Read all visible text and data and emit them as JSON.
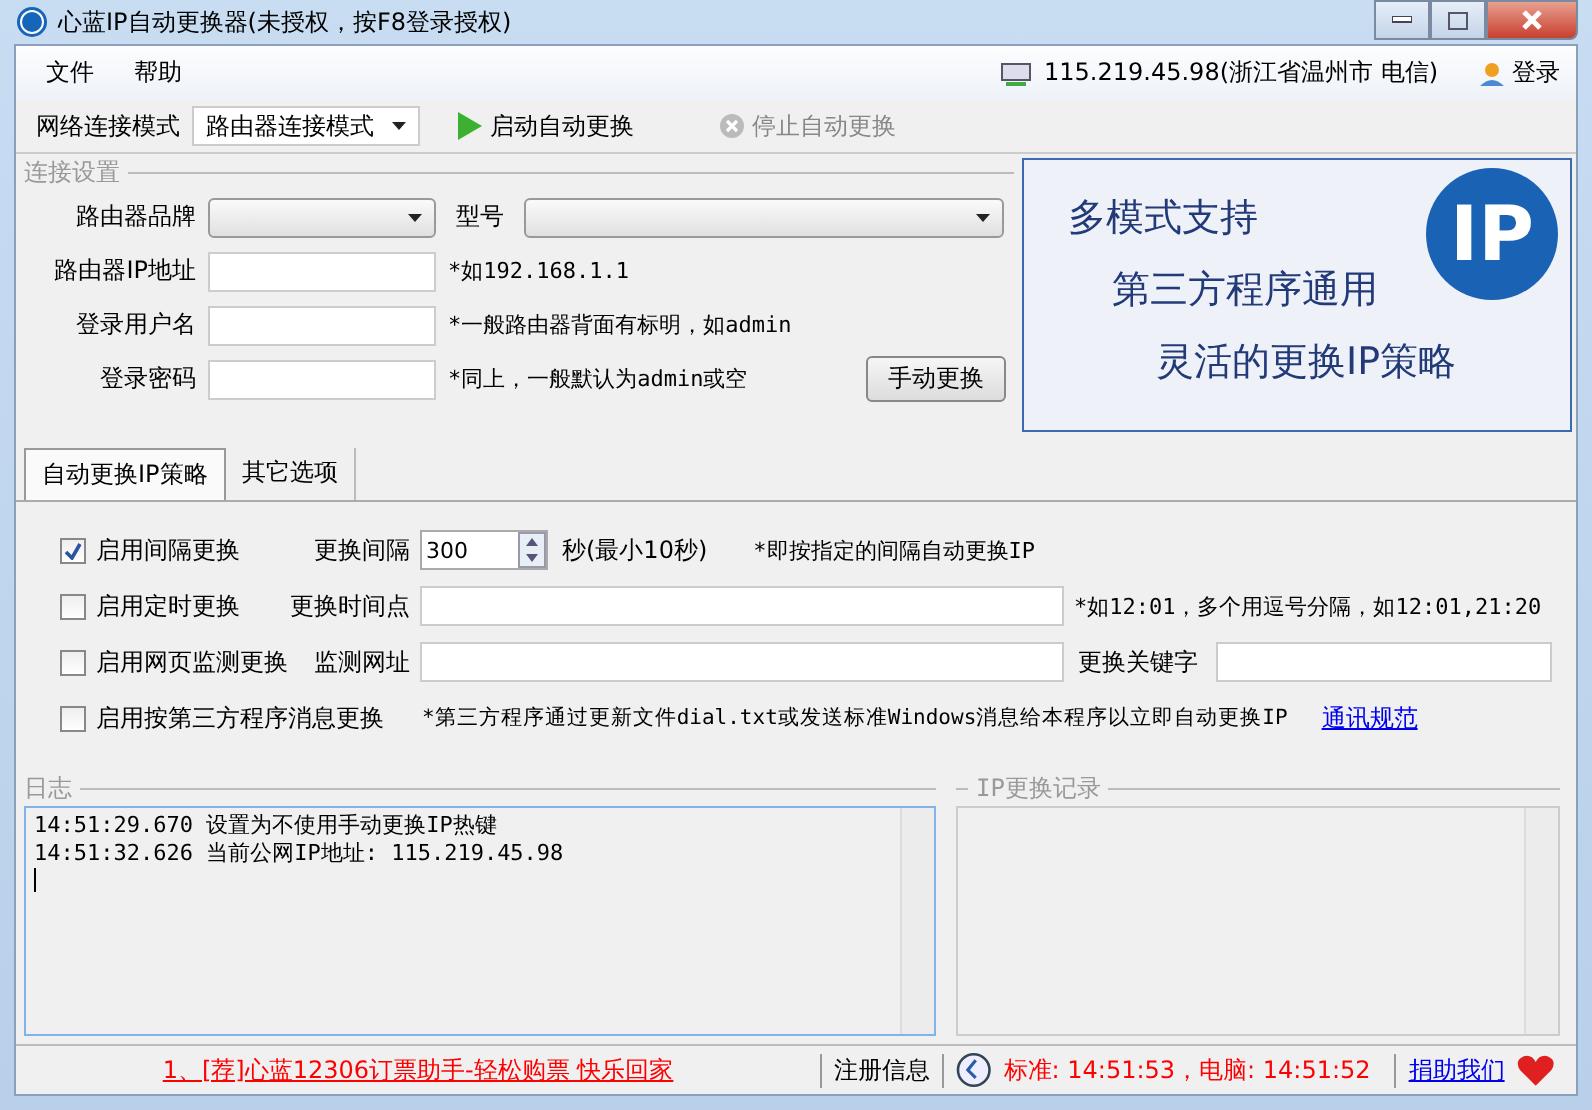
{
  "window": {
    "title": "心蓝IP自动更换器(未授权，按F8登录授权)"
  },
  "menu": [
    "文件",
    "帮助"
  ],
  "ip_status": "115.219.45.98(浙江省温州市 电信)",
  "login": "登录",
  "toolbar": {
    "mode_label": "网络连接模式",
    "mode_value": "路由器连接模式",
    "actions": [
      {
        "label": "启动自动更换",
        "kind": "start",
        "disabled": false
      },
      {
        "label": "停止自动更换",
        "kind": "stop",
        "disabled": true
      }
    ]
  },
  "connection": {
    "title": "连接设置",
    "brand_label": "路由器品牌",
    "model_label": "型号",
    "fields": [
      {
        "label": "路由器IP地址",
        "hint": "*如192.168.1.1"
      },
      {
        "label": "登录用户名",
        "hint": "*一般路由器背面有标明，如admin"
      },
      {
        "label": "登录密码",
        "hint": "*同上，一般默认为admin或空"
      }
    ],
    "button": "手动更换"
  },
  "banner": {
    "logo_text": "IP",
    "lines": [
      "多模式支持",
      "第三方程序通用",
      "灵活的更换IP策略"
    ]
  },
  "tabs": [
    {
      "label": "自动更换IP策略",
      "selected": true
    },
    {
      "label": "其它选项",
      "selected": false
    }
  ],
  "strategies": [
    {
      "label": "启用间隔更换",
      "checked": true,
      "kind": "spinner",
      "field_label": "更换间隔",
      "value": "300",
      "note": "秒(最小10秒)",
      "hint": "*即按指定的间隔自动更换IP"
    },
    {
      "label": "启用定时更换",
      "checked": false,
      "kind": "text",
      "field_label": "更换时间点",
      "hint": "*如12:01，多个用逗号分隔，如12:01,21:20"
    },
    {
      "label": "启用网页监测更换",
      "checked": false,
      "kind": "keyword",
      "field_label": "监测网址",
      "extra_label": "更换关键字"
    },
    {
      "label": "启用按第三方程序消息更换",
      "checked": false,
      "kind": "message",
      "hint": "*第三方程序通过更新文件dial.txt或发送标准Windows消息给本程序以立即自动更换IP",
      "link": "通讯规范"
    }
  ],
  "log": {
    "title": "日志",
    "lines": [
      "14:51:29.670 设置为不使用手动更换IP热键",
      "14:51:32.626 当前公网IP地址: 115.219.45.98"
    ]
  },
  "ip_history": {
    "title": "IP更换记录"
  },
  "status_bar": {
    "ad": "1、[荐]心蓝12306订票助手-轻松购票 快乐回家",
    "register": "注册信息",
    "time": "标准: 14:51:53，电脑: 14:51:52",
    "donate": "捐助我们"
  }
}
